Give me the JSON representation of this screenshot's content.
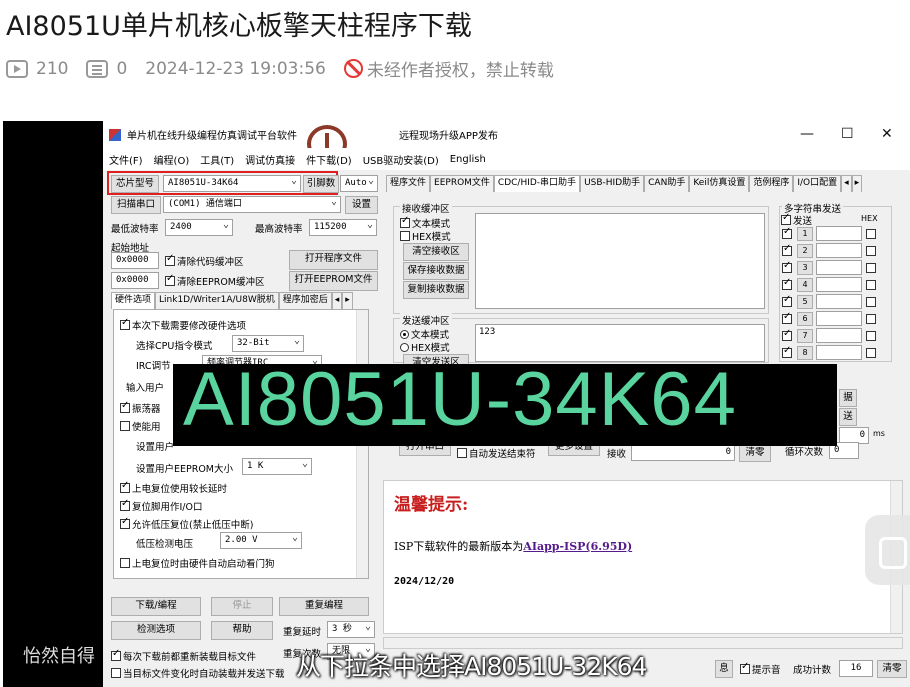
{
  "page": {
    "title": "AI8051U单片机核心板擎天柱程序下载",
    "views": "210",
    "comments": "0",
    "datetime": "2024-12-23 19:03:56",
    "notice": "未经作者授权，禁止转载"
  },
  "app": {
    "title": "单片机在线升级编程仿真调试平台软件",
    "title2": "远程现场升级APP发布",
    "menu": [
      "文件(F)",
      "编程(O)",
      "工具(T)",
      "调试仿真接",
      "件下载(D)",
      "USB驱动安装(D)",
      "English"
    ],
    "chip_label": "芯片型号",
    "chip_value": "AI8051U-34K64",
    "pins_label": "引脚数",
    "pins_value": "Auto",
    "scan_button": "扫描串口",
    "com_value": "(COM1) 通信端口",
    "settings_button": "设置",
    "min_baud_label": "最低波特率",
    "min_baud": "2400",
    "max_baud_label": "最高波特率",
    "max_baud": "115200",
    "start_addr_label": "起始地址",
    "addr1": "0x0000",
    "addr2": "0x0000",
    "clear_code_label": "清除代码缓冲区",
    "clear_eeprom_label": "清除EEPROM缓冲区",
    "open_program_button": "打开程序文件",
    "open_eeprom_button": "打开EEPROM文件",
    "left_tabs": [
      "硬件选项",
      "Link1D/Writer1A/U8W脱机",
      "程序加密后"
    ],
    "hw_options": {
      "opt1": "本次下载需要修改硬件选项",
      "cpu_mode_label": "选择CPU指令模式",
      "cpu_mode": "32-Bit",
      "irc_label": "IRC调节",
      "irc_value": "频率调节器IRC",
      "user_label": "输入用户",
      "osc_label": "振荡器",
      "enable_label": "使能用",
      "set_user_label": "设置用户",
      "eeprom_size_label": "设置用户EEPROM大小",
      "eeprom_size": "1 K",
      "power_reset": "上电复位使用较长延时",
      "reset_pin": "复位脚用作I/O口",
      "lowv_reset": "允许低压复位(禁止低压中断)",
      "lowv_label": "低压检测电压",
      "lowv_value": "2.00 V",
      "wdt": "上电复位时由硬件自动启动看门狗"
    },
    "download_button": "下载/编程",
    "stop_button": "停止",
    "reprogram_button": "重复编程",
    "check_button": "检测选项",
    "help_button": "帮助",
    "repeat_delay_label": "重复延时",
    "repeat_delay": "3 秒",
    "repeat_count_label": "重复次数",
    "repeat_count": "无限",
    "reload_label": "每次下载前都重新装载目标文件",
    "autoload_label": "当目标文件变化时自动装载并发送下载",
    "right_tabs": [
      "程序文件",
      "EEPROM文件",
      "CDC/HID-串口助手",
      "USB-HID助手",
      "CAN助手",
      "Keil仿真设置",
      "范例程序",
      "I/O口配置"
    ],
    "recv_group": "接收缓冲区",
    "text_mode": "文本模式",
    "hex_mode": "HEX模式",
    "clear_recv": "清空接收区",
    "save_recv": "保存接收数据",
    "copy_recv": "复制接收数据",
    "send_group": "发送缓冲区",
    "send_content": "123",
    "clear_send": "清空发送区",
    "multi_group": "多字符串发送",
    "send_col": "发送",
    "hex_col": "HEX",
    "multi_rows": [
      "1",
      "2",
      "3",
      "4",
      "5",
      "6",
      "7",
      "8"
    ],
    "open_port": "打开串口",
    "auto_send_end": "自动发送结束符",
    "more_settings": "更多设置",
    "recv_label": "接收",
    "recv_count": "0",
    "clear_btn": "清零",
    "loop_label": "循环次数",
    "loop_count": "0",
    "interval_value": "0",
    "interval_unit": "ms",
    "partial1": "据",
    "partial2": "送",
    "tip_title": "温馨提示:",
    "tip_text": "ISP下载软件的最新版本为",
    "tip_link": "AIapp-ISP(6.95D)",
    "tip_date": "2024/12/20",
    "sound_label": "提示音",
    "success_label": "成功计数",
    "success_count": "16",
    "clear_count_btn": "清零",
    "partial_btn": "息"
  },
  "overlay": {
    "big_text": "AI8051U-34K64",
    "subtitle": "从下拉条中选择AI8051U-32K64",
    "watermark": "怡然自得"
  },
  "colors": {
    "annotation_red": "#e02020",
    "big_text": "#5ad49e",
    "tip_red": "#c81e1e"
  }
}
